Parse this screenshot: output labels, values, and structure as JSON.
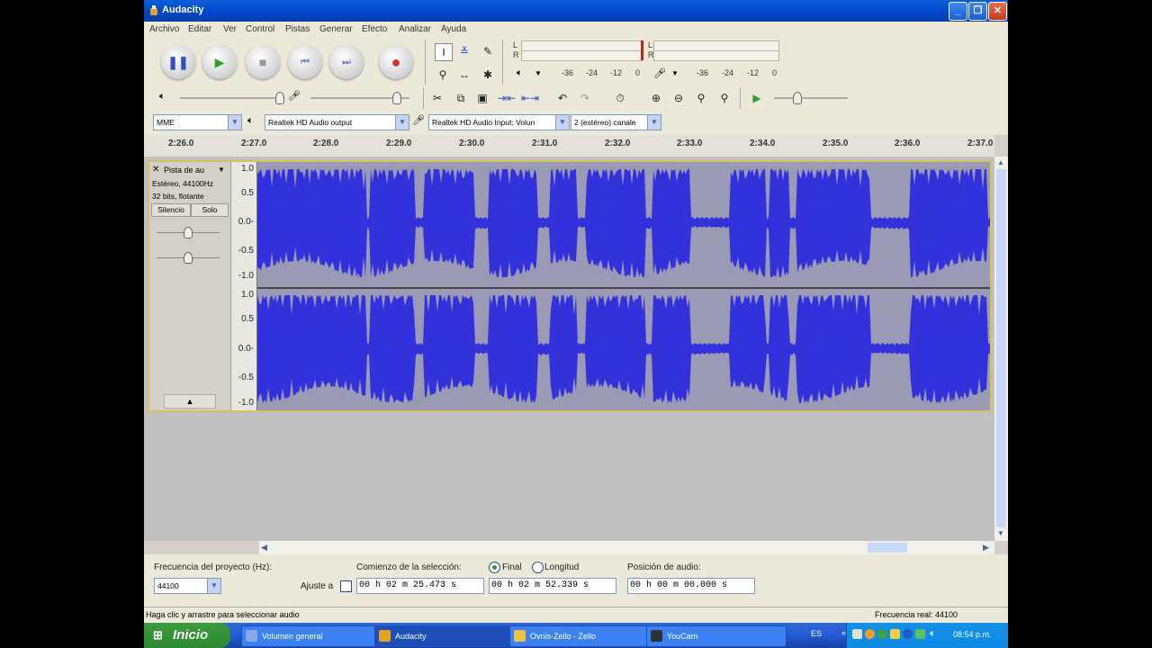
{
  "window": {
    "title": "Audacity"
  },
  "menu": [
    "Archivo",
    "Editar",
    "Ver",
    "Control",
    "Pistas",
    "Generar",
    "Efecto",
    "Analizar",
    "Ayuda"
  ],
  "meters": {
    "playback_channels": [
      "L",
      "R"
    ],
    "record_channels": [
      "L",
      "R"
    ],
    "playback_scale": [
      "-36",
      "-24",
      "-12",
      "0"
    ],
    "record_scale": [
      "-36",
      "-24",
      "-12",
      "0"
    ]
  },
  "devices": {
    "host": "MME",
    "output": "Realtek HD Audio output",
    "input": "Realtek HD Audio Input: Volun",
    "channels": "2 (estéreo) canale"
  },
  "timeline": [
    "2:26.0",
    "2:27.0",
    "2:28.0",
    "2:29.0",
    "2:30.0",
    "2:31.0",
    "2:32.0",
    "2:33.0",
    "2:34.0",
    "2:35.0",
    "2:36.0",
    "2:37.0"
  ],
  "track": {
    "name": "Pista de au",
    "info1": "Estéreo, 44100Hz",
    "info2": "32 bits, flotante",
    "mute": "Silencio",
    "solo": "Solo",
    "scale": [
      "1.0",
      "0.5",
      "0.0-",
      "-0.5",
      "-1.0"
    ]
  },
  "bottom": {
    "rate_label": "Frecuencia del proyecto (Hz):",
    "rate_value": "44100",
    "snap_label": "Ajuste a",
    "sel_start_label": "Comienzo de la selección:",
    "end_label": "Final",
    "length_label": "Longitud",
    "audio_pos_label": "Posición de audio:",
    "sel_start": "00 h 02 m 25.473 s",
    "sel_end": "00 h 02 m 52.339 s",
    "audio_pos": "00 h 00 m 00.000 s"
  },
  "status": {
    "left": "Haga clic y arrastre para seleccionar audio",
    "right": "Frecuencia real: 44100"
  },
  "taskbar": {
    "start": "Inicio",
    "tasks": [
      "Volumen general",
      "Audacity",
      "Ovnis-Zello - Zello",
      "YouCam"
    ],
    "lang": "ES",
    "clock": "08:54 p.m."
  },
  "colors": {
    "wave": "#3232dc",
    "wave_bg": "#9a9ab4",
    "selection_border": "#d8c060"
  }
}
